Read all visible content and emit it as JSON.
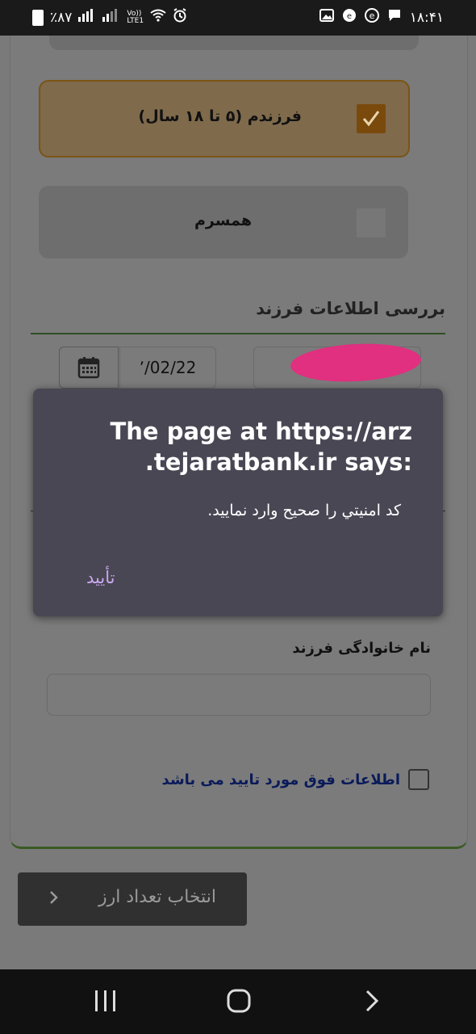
{
  "status_bar": {
    "time": "۱۸:۴۱",
    "battery": "٪۸۷",
    "network": "LTE1",
    "volte": "Vo))"
  },
  "form": {
    "option_child": "فرزندم (۵ تا ۱۸ سال)",
    "option_child_checked": true,
    "option_spouse": "همسرم",
    "option_spouse_checked": false,
    "section_title": "بررسی اطلاعات فرزند",
    "birth_date": "٬/02/22",
    "family_name_label": "نام خانوادگی فرزند",
    "family_name_value": "",
    "confirm_label": "اطلاعات فوق مورد تایید می باشد",
    "next_button": "انتخاب تعداد ارز"
  },
  "dialog": {
    "title_line1": "The page at https://arz",
    "title_line2": ".tejaratbank.ir says:",
    "message": "کد امنيتي را صحيح وارد نماييد.",
    "ok_button": "تأیید"
  },
  "colors": {
    "child_accent": "#7a4a0c",
    "confirm_text": "#0a1a5a",
    "dialog_bg": "#4a4754",
    "dialog_button": "#c9a8f0",
    "section_line": "#2f4f24"
  },
  "icons": {
    "calendar": "calendar-icon",
    "check": "checkmark-icon",
    "chevron": "chevron-left-icon",
    "nav_recent": "recent-apps-icon",
    "nav_home": "home-icon",
    "nav_back": "back-icon"
  }
}
